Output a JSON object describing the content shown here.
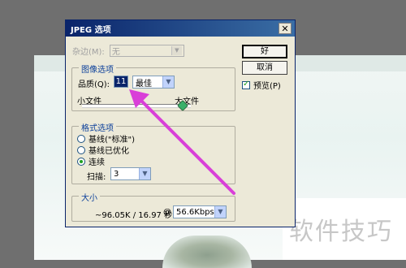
{
  "dialog": {
    "title": "JPEG 选项",
    "close_glyph": "✕",
    "matte": {
      "label": "杂边(M):",
      "value": "无"
    },
    "image_options": {
      "group_label": "图像选项",
      "quality_label": "品质(Q):",
      "quality_value": "11",
      "quality_preset": "最佳",
      "small_file_label": "小文件",
      "large_file_label": "大文件",
      "slider_level_fraction": 0.92
    },
    "format_options": {
      "group_label": "格式选项",
      "options": [
        {
          "label": "基线(\"标准\")",
          "checked": false
        },
        {
          "label": "基线已优化",
          "checked": false
        },
        {
          "label": "连续",
          "checked": true
        }
      ],
      "scans_label": "扫描:",
      "scans_value": "3"
    },
    "size": {
      "group_label": "大小",
      "size_text": "~96.05K / 16.97 秒",
      "at_symbol": "@",
      "speed_value": "56.6Kbps"
    },
    "buttons": {
      "ok": "好",
      "cancel": "取消"
    },
    "preview": {
      "label": "预览(P)",
      "checked": true
    }
  },
  "watermark": "软件技巧",
  "annotation": {
    "arrow_color": "#d93fd8"
  }
}
